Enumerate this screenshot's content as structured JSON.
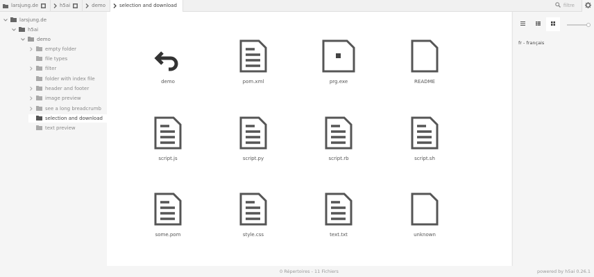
{
  "breadcrumbs": [
    {
      "label": "larsjung.de"
    },
    {
      "label": "h5ai"
    },
    {
      "label": "demo"
    },
    {
      "label": "selection and download"
    }
  ],
  "filter": {
    "placeholder": "filtre"
  },
  "tree": [
    {
      "label": "larsjung.de"
    },
    {
      "label": "h5ai"
    },
    {
      "label": "demo"
    },
    {
      "label": "empty folder"
    },
    {
      "label": "file types"
    },
    {
      "label": "filter"
    },
    {
      "label": "folder with index file"
    },
    {
      "label": "header and footer"
    },
    {
      "label": "image preview"
    },
    {
      "label": "see a long breadcrumb"
    },
    {
      "label": "selection and download"
    },
    {
      "label": "text preview"
    }
  ],
  "files": [
    {
      "name": "demo",
      "icon": "back-arrow-icon"
    },
    {
      "name": "pom.xml",
      "icon": "text-file-icon"
    },
    {
      "name": "prg.exe",
      "icon": "binary-file-icon"
    },
    {
      "name": "README",
      "icon": "blank-file-icon"
    },
    {
      "name": "script.js",
      "icon": "text-file-icon"
    },
    {
      "name": "script.py",
      "icon": "text-file-icon"
    },
    {
      "name": "script.rb",
      "icon": "text-file-icon"
    },
    {
      "name": "script.sh",
      "icon": "text-file-icon"
    },
    {
      "name": "some.pom",
      "icon": "text-file-icon"
    },
    {
      "name": "style.css",
      "icon": "text-file-icon"
    },
    {
      "name": "text.txt",
      "icon": "text-file-icon"
    },
    {
      "name": "unknown",
      "icon": "blank-file-icon"
    }
  ],
  "settings": {
    "language": "fr - français"
  },
  "status": {
    "counts": "0 Répertoires - 11 Fichiers",
    "powered": "powered by h5ai 0.26.1"
  }
}
